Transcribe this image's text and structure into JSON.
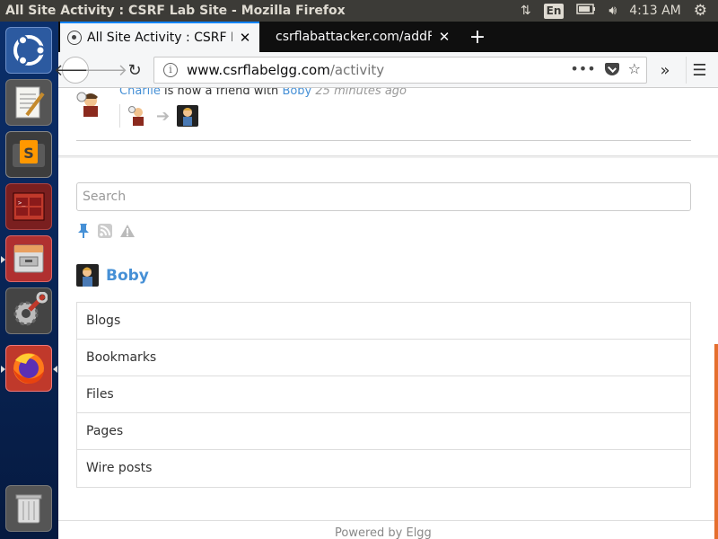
{
  "window": {
    "title": "All Site Activity : CSRF Lab Site - Mozilla Firefox"
  },
  "tray": {
    "lang": "En",
    "time": "4:13 AM"
  },
  "launcher": {
    "items": [
      "ubuntu-dash",
      "text-editor",
      "sublime-text",
      "terminal",
      "file-manager",
      "system-settings",
      "firefox",
      "trash"
    ]
  },
  "tabs": [
    {
      "title": "All Site Activity : CSRF La",
      "active": true
    },
    {
      "title": "csrflabattacker.com/addFri",
      "active": false
    }
  ],
  "urlbar": {
    "host": "www.csrflabelgg.com",
    "path": "/activity"
  },
  "activity": {
    "subject": "Charlie",
    "text": " is now a friend with ",
    "object": "Boby",
    "time": " 25 minutes ago"
  },
  "sidebar": {
    "search_placeholder": "Search",
    "owner_name": "Boby",
    "menu": [
      "Blogs",
      "Bookmarks",
      "Files",
      "Pages",
      "Wire posts"
    ]
  },
  "footer": {
    "text": "Powered by Elgg"
  },
  "colors": {
    "accent": "#4690d6",
    "firefox_blue": "#0a84ff",
    "scroll": "#e56f2e"
  }
}
